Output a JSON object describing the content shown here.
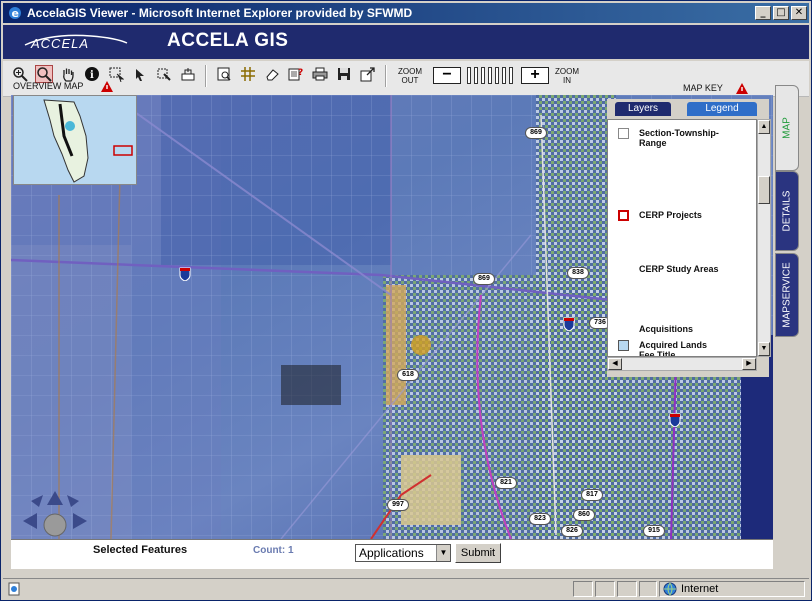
{
  "window": {
    "title": "AccelaGIS Viewer - Microsoft Internet Explorer provided by SFWMD",
    "minimize": "_",
    "maximize": "□",
    "close": "✕"
  },
  "header": {
    "logo": "ACCELA",
    "title": "ACCELA GIS"
  },
  "toolbar": {
    "tools": [
      {
        "icon": "zoom-in-icon"
      },
      {
        "icon": "zoom-box-icon"
      },
      {
        "icon": "pan-hand-icon"
      },
      {
        "icon": "info-icon"
      },
      {
        "icon": "select-box-icon"
      },
      {
        "icon": "select-point-icon"
      },
      {
        "icon": "select-line-icon"
      },
      {
        "icon": "clear-selection-icon"
      },
      {
        "icon": "find-icon"
      },
      {
        "icon": "grid-icon"
      },
      {
        "icon": "eraser-icon"
      },
      {
        "icon": "query-icon"
      },
      {
        "icon": "print-icon"
      },
      {
        "icon": "save-icon"
      },
      {
        "icon": "export-icon"
      }
    ],
    "zoom_out_label": "ZOOM OUT",
    "zoom_in_label": "ZOOM IN",
    "zoom_out_symbol": "−",
    "zoom_in_symbol": "+",
    "overview_label": "OVERVIEW MAP",
    "mapkey_label": "MAP KEY"
  },
  "map": {
    "road_shields": [
      "869",
      "869",
      "838",
      "736",
      "618",
      "821",
      "817",
      "860",
      "823",
      "826",
      "915",
      "997"
    ],
    "interstate_shields": [
      "595",
      "75",
      "95"
    ]
  },
  "legend": {
    "tabs": [
      "Layers",
      "Legend"
    ],
    "active_tab": "Legend",
    "items": [
      {
        "label": "Section-Township-Range",
        "symbol": "empty-box"
      },
      {
        "label": "CERP Projects",
        "symbol": "red-box"
      },
      {
        "label": "CERP Study Areas",
        "symbol": "none"
      },
      {
        "label": "Acquisitions",
        "symbol": "none"
      },
      {
        "label": "Acquired Lands Fee Title",
        "symbol": "blue-box"
      }
    ]
  },
  "side_tabs": [
    "MAP",
    "DETAILS",
    "MAPSERVICE"
  ],
  "bottom": {
    "selected_features_label": "Selected Features",
    "count_label": "Count: 1",
    "select_value": "Applications",
    "submit_label": "Submit"
  },
  "status": {
    "zone": "Internet"
  },
  "colors": {
    "title_bar": "#0a246a",
    "header": "#1f2a6e",
    "accent_red": "#cc0000",
    "tab_blue": "#2a3480"
  }
}
